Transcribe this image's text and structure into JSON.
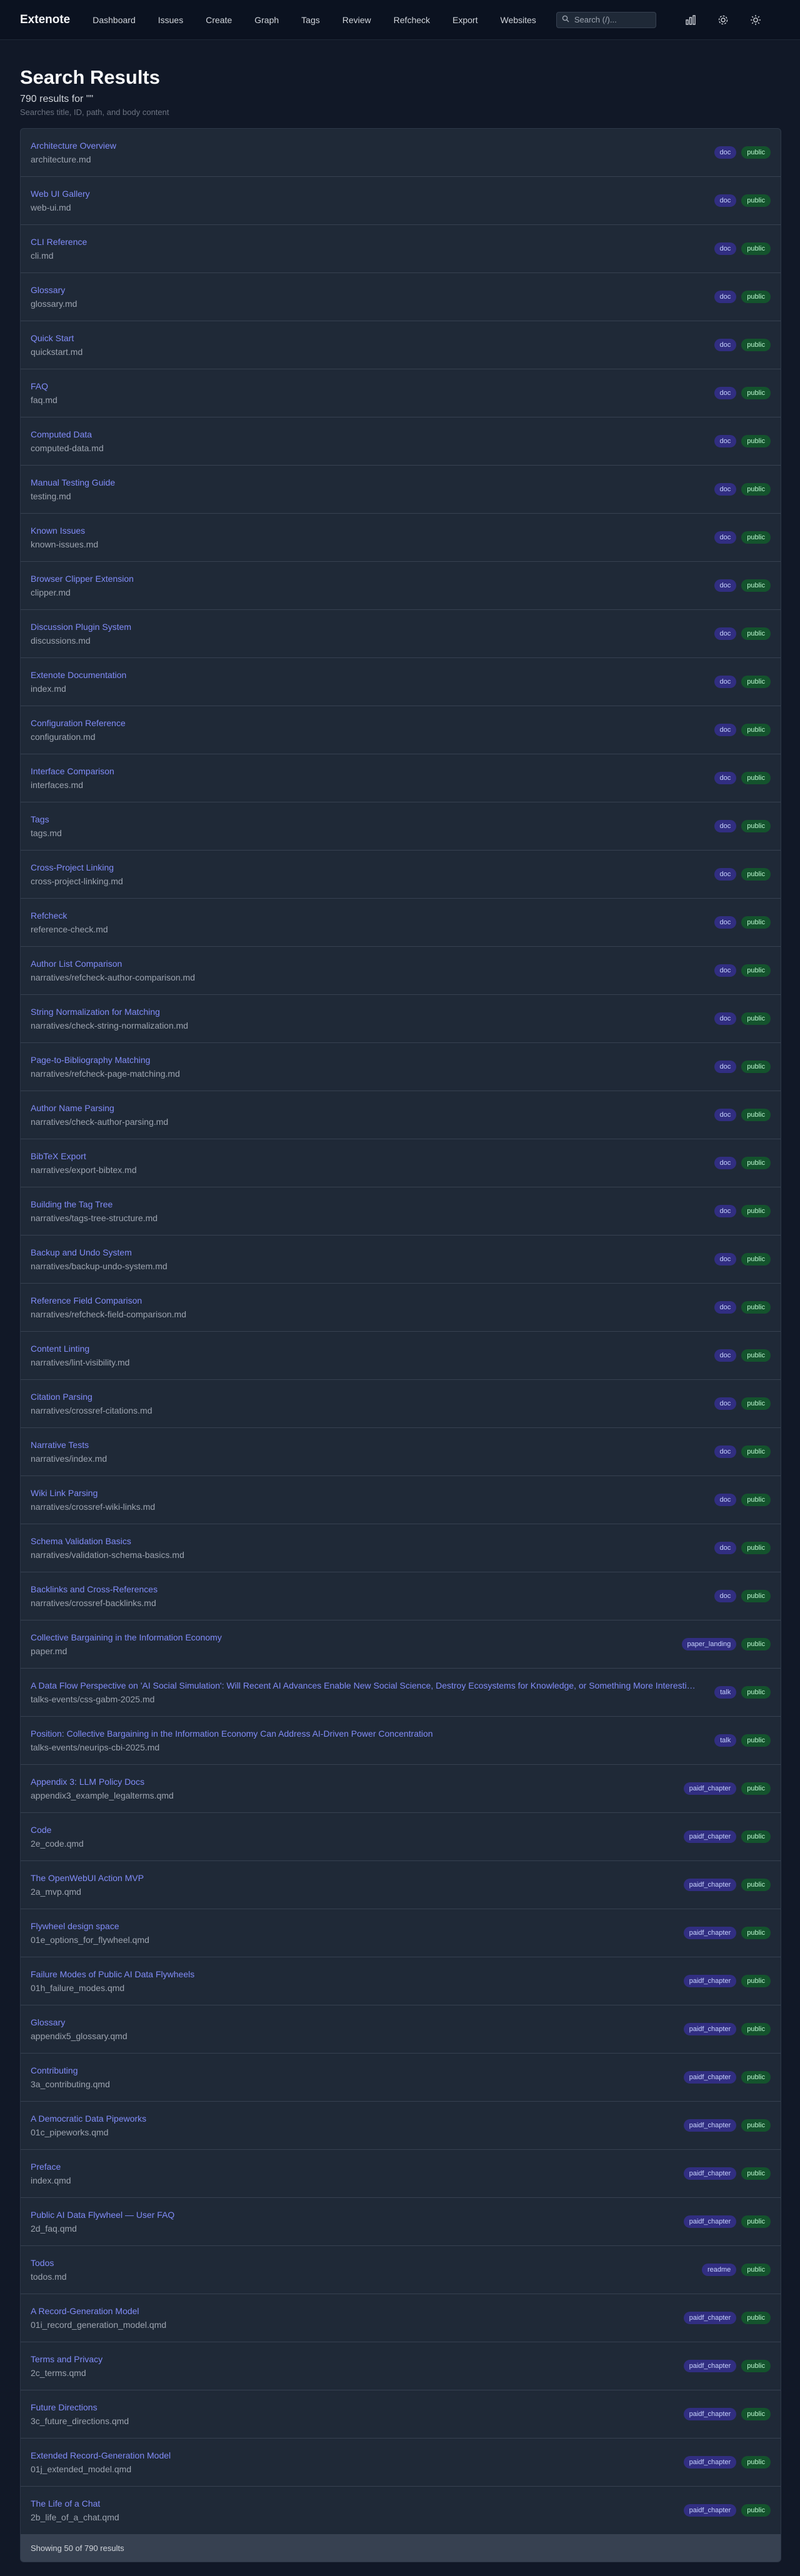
{
  "nav": {
    "brand": "Extenote",
    "links": [
      "Dashboard",
      "Issues",
      "Create",
      "Graph",
      "Tags",
      "Review",
      "Refcheck",
      "Export",
      "Websites"
    ],
    "search_placeholder": "Search (/)..."
  },
  "page": {
    "title": "Search Results",
    "count_text": "790 results for \"\"",
    "hint": "Searches title, ID, path, and body content"
  },
  "results": [
    {
      "title": "Architecture Overview",
      "path": "architecture.md",
      "type": "doc",
      "visibility": "public"
    },
    {
      "title": "Web UI Gallery",
      "path": "web-ui.md",
      "type": "doc",
      "visibility": "public"
    },
    {
      "title": "CLI Reference",
      "path": "cli.md",
      "type": "doc",
      "visibility": "public"
    },
    {
      "title": "Glossary",
      "path": "glossary.md",
      "type": "doc",
      "visibility": "public"
    },
    {
      "title": "Quick Start",
      "path": "quickstart.md",
      "type": "doc",
      "visibility": "public"
    },
    {
      "title": "FAQ",
      "path": "faq.md",
      "type": "doc",
      "visibility": "public"
    },
    {
      "title": "Computed Data",
      "path": "computed-data.md",
      "type": "doc",
      "visibility": "public"
    },
    {
      "title": "Manual Testing Guide",
      "path": "testing.md",
      "type": "doc",
      "visibility": "public"
    },
    {
      "title": "Known Issues",
      "path": "known-issues.md",
      "type": "doc",
      "visibility": "public"
    },
    {
      "title": "Browser Clipper Extension",
      "path": "clipper.md",
      "type": "doc",
      "visibility": "public"
    },
    {
      "title": "Discussion Plugin System",
      "path": "discussions.md",
      "type": "doc",
      "visibility": "public"
    },
    {
      "title": "Extenote Documentation",
      "path": "index.md",
      "type": "doc",
      "visibility": "public"
    },
    {
      "title": "Configuration Reference",
      "path": "configuration.md",
      "type": "doc",
      "visibility": "public"
    },
    {
      "title": "Interface Comparison",
      "path": "interfaces.md",
      "type": "doc",
      "visibility": "public"
    },
    {
      "title": "Tags",
      "path": "tags.md",
      "type": "doc",
      "visibility": "public"
    },
    {
      "title": "Cross-Project Linking",
      "path": "cross-project-linking.md",
      "type": "doc",
      "visibility": "public"
    },
    {
      "title": "Refcheck",
      "path": "reference-check.md",
      "type": "doc",
      "visibility": "public"
    },
    {
      "title": "Author List Comparison",
      "path": "narratives/refcheck-author-comparison.md",
      "type": "doc",
      "visibility": "public"
    },
    {
      "title": "String Normalization for Matching",
      "path": "narratives/check-string-normalization.md",
      "type": "doc",
      "visibility": "public"
    },
    {
      "title": "Page-to-Bibliography Matching",
      "path": "narratives/refcheck-page-matching.md",
      "type": "doc",
      "visibility": "public"
    },
    {
      "title": "Author Name Parsing",
      "path": "narratives/check-author-parsing.md",
      "type": "doc",
      "visibility": "public"
    },
    {
      "title": "BibTeX Export",
      "path": "narratives/export-bibtex.md",
      "type": "doc",
      "visibility": "public"
    },
    {
      "title": "Building the Tag Tree",
      "path": "narratives/tags-tree-structure.md",
      "type": "doc",
      "visibility": "public"
    },
    {
      "title": "Backup and Undo System",
      "path": "narratives/backup-undo-system.md",
      "type": "doc",
      "visibility": "public"
    },
    {
      "title": "Reference Field Comparison",
      "path": "narratives/refcheck-field-comparison.md",
      "type": "doc",
      "visibility": "public"
    },
    {
      "title": "Content Linting",
      "path": "narratives/lint-visibility.md",
      "type": "doc",
      "visibility": "public"
    },
    {
      "title": "Citation Parsing",
      "path": "narratives/crossref-citations.md",
      "type": "doc",
      "visibility": "public"
    },
    {
      "title": "Narrative Tests",
      "path": "narratives/index.md",
      "type": "doc",
      "visibility": "public"
    },
    {
      "title": "Wiki Link Parsing",
      "path": "narratives/crossref-wiki-links.md",
      "type": "doc",
      "visibility": "public"
    },
    {
      "title": "Schema Validation Basics",
      "path": "narratives/validation-schema-basics.md",
      "type": "doc",
      "visibility": "public"
    },
    {
      "title": "Backlinks and Cross-References",
      "path": "narratives/crossref-backlinks.md",
      "type": "doc",
      "visibility": "public"
    },
    {
      "title": "Collective Bargaining in the Information Economy",
      "path": "paper.md",
      "type": "paper_landing",
      "visibility": "public"
    },
    {
      "title": "A Data Flow Perspective on 'AI Social Simulation': Will Recent AI Advances Enable New Social Science, Destroy Ecosystems for Knowledge, or Something More Interesting?",
      "path": "talks-events/css-gabm-2025.md",
      "type": "talk",
      "visibility": "public"
    },
    {
      "title": "Position: Collective Bargaining in the Information Economy Can Address AI-Driven Power Concentration",
      "path": "talks-events/neurips-cbi-2025.md",
      "type": "talk",
      "visibility": "public"
    },
    {
      "title": "Appendix 3: LLM Policy Docs",
      "path": "appendix3_example_legalterms.qmd",
      "type": "paidf_chapter",
      "visibility": "public"
    },
    {
      "title": "Code",
      "path": "2e_code.qmd",
      "type": "paidf_chapter",
      "visibility": "public"
    },
    {
      "title": "The OpenWebUI Action MVP",
      "path": "2a_mvp.qmd",
      "type": "paidf_chapter",
      "visibility": "public"
    },
    {
      "title": "Flywheel design space",
      "path": "01e_options_for_flywheel.qmd",
      "type": "paidf_chapter",
      "visibility": "public"
    },
    {
      "title": "Failure Modes of Public AI Data Flywheels",
      "path": "01h_failure_modes.qmd",
      "type": "paidf_chapter",
      "visibility": "public"
    },
    {
      "title": "Glossary",
      "path": "appendix5_glossary.qmd",
      "type": "paidf_chapter",
      "visibility": "public"
    },
    {
      "title": "Contributing",
      "path": "3a_contributing.qmd",
      "type": "paidf_chapter",
      "visibility": "public"
    },
    {
      "title": "A Democratic Data Pipeworks",
      "path": "01c_pipeworks.qmd",
      "type": "paidf_chapter",
      "visibility": "public"
    },
    {
      "title": "Preface",
      "path": "index.qmd",
      "type": "paidf_chapter",
      "visibility": "public"
    },
    {
      "title": "Public AI Data Flywheel — User FAQ",
      "path": "2d_faq.qmd",
      "type": "paidf_chapter",
      "visibility": "public"
    },
    {
      "title": "Todos",
      "path": "todos.md",
      "type": "readme",
      "visibility": "public"
    },
    {
      "title": "A Record-Generation Model",
      "path": "01i_record_generation_model.qmd",
      "type": "paidf_chapter",
      "visibility": "public"
    },
    {
      "title": "Terms and Privacy",
      "path": "2c_terms.qmd",
      "type": "paidf_chapter",
      "visibility": "public"
    },
    {
      "title": "Future Directions",
      "path": "3c_future_directions.qmd",
      "type": "paidf_chapter",
      "visibility": "public"
    },
    {
      "title": "Extended Record-Generation Model",
      "path": "01j_extended_model.qmd",
      "type": "paidf_chapter",
      "visibility": "public"
    },
    {
      "title": "The Life of a Chat",
      "path": "2b_life_of_a_chat.qmd",
      "type": "paidf_chapter",
      "visibility": "public"
    }
  ],
  "footer": {
    "text": "Showing 50 of 790 results"
  },
  "colors": {
    "background": "#111827",
    "panel": "#1f2937",
    "link": "#818cf8",
    "type_badge": "#312e81",
    "public_badge": "#14532d"
  },
  "icons": [
    "search-icon",
    "chart-icon",
    "gear-icon",
    "sun-icon"
  ]
}
